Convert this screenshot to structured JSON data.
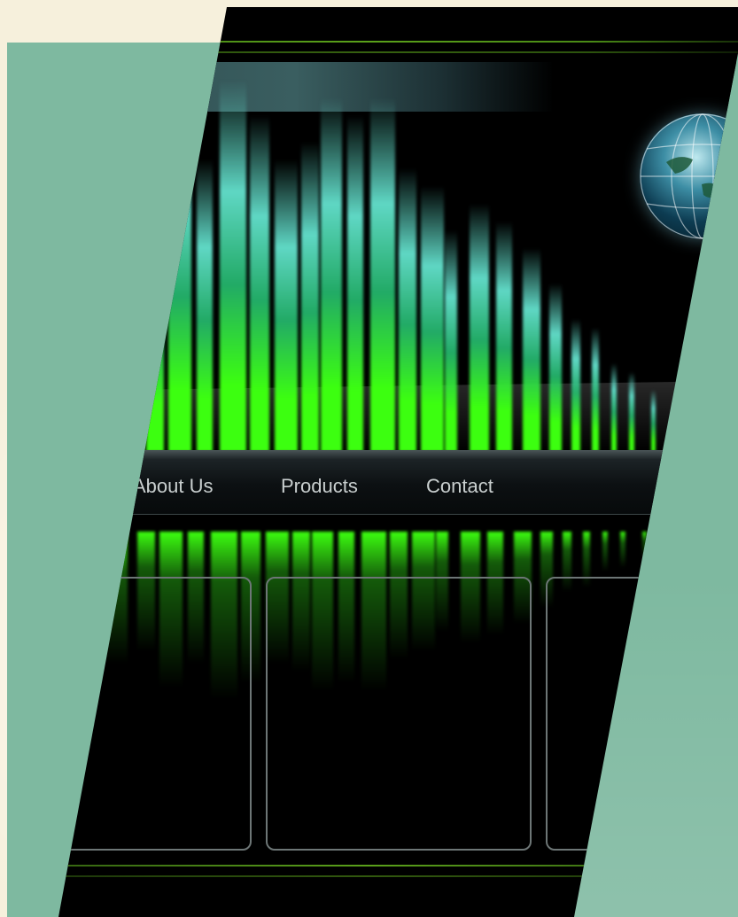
{
  "nav": {
    "items": [
      {
        "label": "About Us"
      },
      {
        "label": "Products"
      },
      {
        "label": "Contact"
      }
    ]
  },
  "colors": {
    "page_background": "#f6f0dc",
    "panel": "#7eb9a0",
    "site_background": "#000000",
    "bar_green": "#3cff10",
    "bar_teal": "#5fd7c4",
    "nav_text": "#c9cfcf",
    "card_border": "#6d7676"
  },
  "icons": {
    "globe": "globe-icon"
  }
}
